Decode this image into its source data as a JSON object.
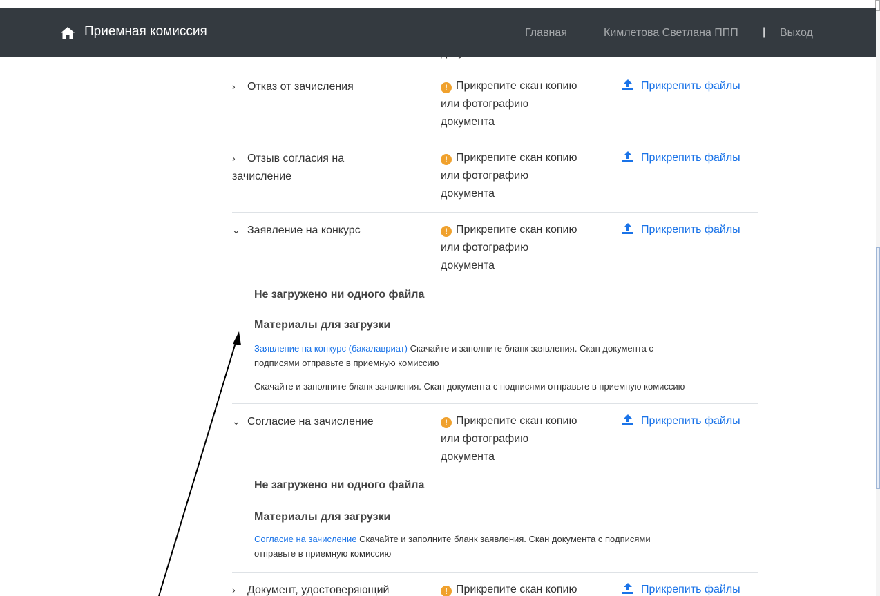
{
  "navbar": {
    "brand": "Приемная комиссия",
    "home_link": "Главная",
    "user": "Кимлетова Светлана ППП",
    "separator": "|",
    "logout": "Выход",
    "bg_color": "#343a40"
  },
  "partial_top_text": "документа",
  "status_text": "Прикрепите скан копию или фотографию документа",
  "status_line1": "Прикрепите скан копию",
  "status_line2": "или фотографию",
  "status_line3": "документа",
  "upload_label": "Прикрепить файлы",
  "rows": [
    {
      "name": "Отказ от зачисления",
      "expanded": false
    },
    {
      "name_line1": "Отзыв согласия на",
      "name_line2": "зачисление",
      "expanded": false
    },
    {
      "name": "Заявление на конкурс",
      "expanded": true,
      "no_files": "Не загружено ни одного файла",
      "materials_title": "Материалы для загрузки",
      "material_link": "Заявление на конкурс (бакалавриат)",
      "material_desc": " Скачайте и заполните бланк заявления. Скан документа с",
      "material_desc2": "подписями отправьте в приемную комиссию",
      "extra_note": "Скачайте и заполните бланк заявления. Скан документа с подписями отправьте в приемную комиссию"
    },
    {
      "name": "Согласие на зачисление",
      "expanded": true,
      "no_files": "Не загружено ни одного файла",
      "materials_title": "Материалы для загрузки",
      "material_link": "Согласие на зачисление",
      "material_desc": " Скачайте и заполните бланк заявления. Скан документа с подписями",
      "material_desc2": "отправьте в приемную комиссию"
    },
    {
      "name": "Документ, удостоверяющий",
      "expanded": false
    }
  ],
  "colors": {
    "warning": "#f0a12d",
    "link": "#1a73e8",
    "divider": "#dee2e6"
  }
}
